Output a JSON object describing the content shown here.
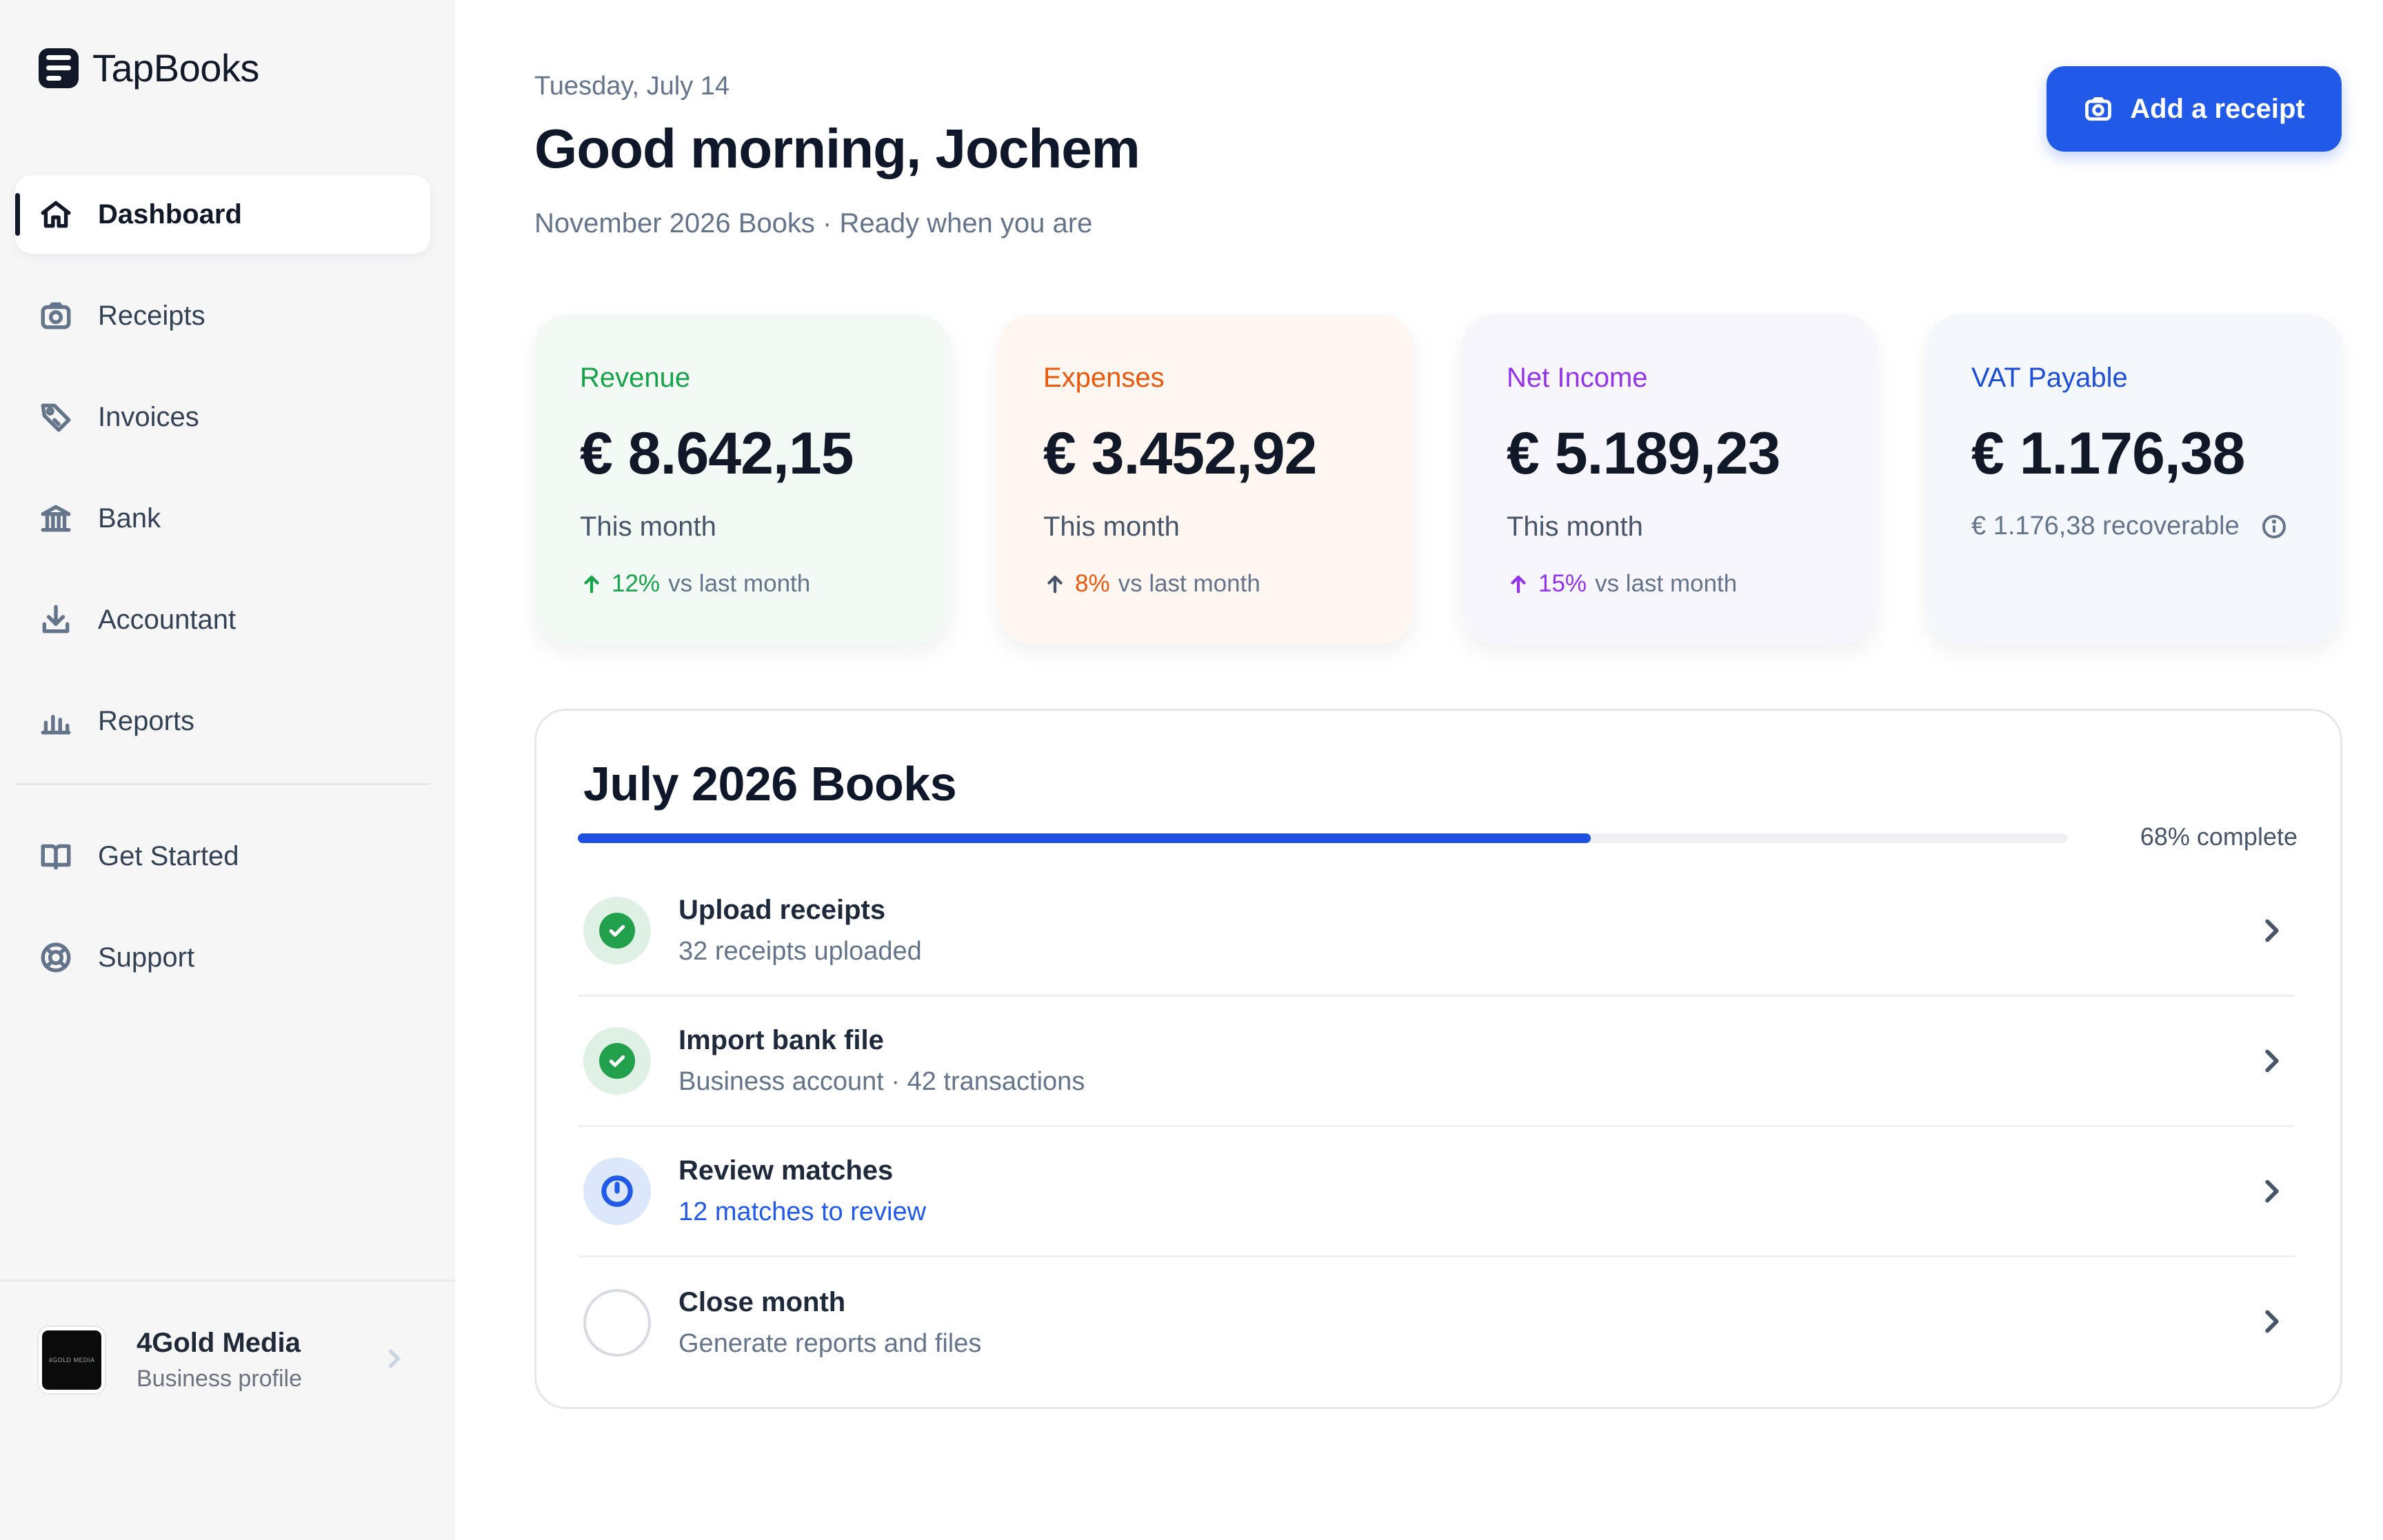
{
  "app": {
    "name": "TapBooks"
  },
  "sidebar": {
    "items": [
      {
        "label": "Dashboard",
        "icon": "home-icon",
        "active": true
      },
      {
        "label": "Receipts",
        "icon": "camera-icon"
      },
      {
        "label": "Invoices",
        "icon": "tag-icon"
      },
      {
        "label": "Bank",
        "icon": "bank-icon"
      },
      {
        "label": "Accountant",
        "icon": "download-icon"
      },
      {
        "label": "Reports",
        "icon": "bar-chart-icon"
      }
    ],
    "secondary": [
      {
        "label": "Get Started",
        "icon": "book-icon"
      },
      {
        "label": "Support",
        "icon": "lifebuoy-icon"
      }
    ],
    "profile": {
      "name": "4Gold Media",
      "subtitle": "Business profile",
      "avatar_text": "4GOLD MEDIA"
    }
  },
  "header": {
    "date": "Tuesday, July 14",
    "greeting": "Good morning, Jochem",
    "subtitle": "November 2026 Books · Ready when you are",
    "add_button": "Add a receipt"
  },
  "cards": [
    {
      "title": "Revenue",
      "amount": "€ 8.642,15",
      "period": "This month",
      "change": "12%",
      "change_suffix": "vs last month",
      "accent": "#16a34a"
    },
    {
      "title": "Expenses",
      "amount": "€ 3.452,92",
      "period": "This month",
      "change": "8%",
      "change_suffix": "vs last month",
      "accent": "#ea580c"
    },
    {
      "title": "Net Income",
      "amount": "€ 5.189,23",
      "period": "This month",
      "change": "15%",
      "change_suffix": "vs last month",
      "accent": "#9333ea"
    },
    {
      "title": "VAT Payable",
      "amount": "€ 1.176,38",
      "recoverable": "€ 1.176,38 recoverable",
      "accent": "#1d4ed8"
    }
  ],
  "books": {
    "title": "July 2026 Books",
    "progress_percent": 68,
    "progress_label": "68% complete",
    "steps": [
      {
        "title": "Upload receipts",
        "subtitle": "32 receipts uploaded",
        "status": "done"
      },
      {
        "title": "Import bank file",
        "subtitle": "Business account · 42 transactions",
        "status": "done"
      },
      {
        "title": "Review matches",
        "subtitle": "12 matches to review",
        "status": "pending"
      },
      {
        "title": "Close month",
        "subtitle": "Generate reports and files",
        "status": "todo"
      }
    ]
  },
  "colors": {
    "primary": "#2159e8",
    "success": "#22a04b",
    "text": "#0f172a"
  }
}
